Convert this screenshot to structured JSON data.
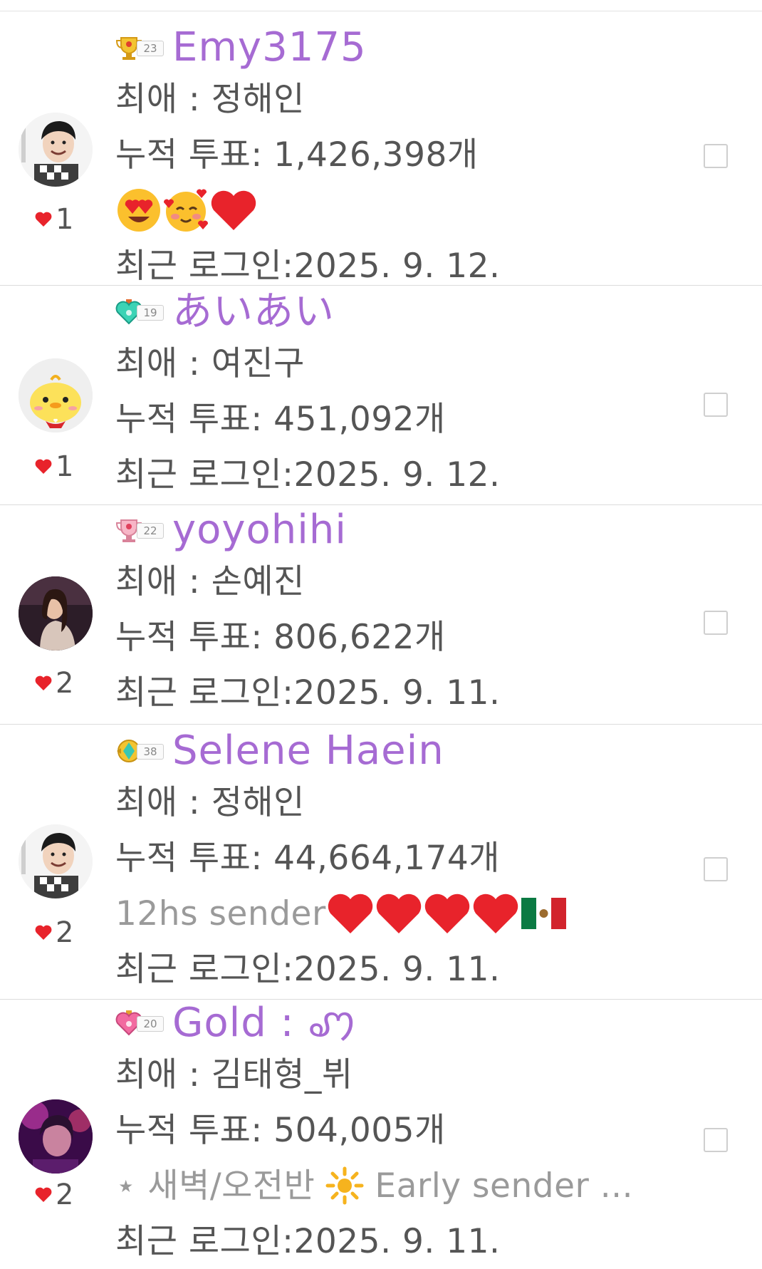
{
  "members": [
    {
      "level": "23",
      "nickname": "Emy3175",
      "favorite": "최애 : 정해인",
      "votes": "누적 투표: 1,426,398개",
      "message": "",
      "last_login": "최근 로그인:2025. 9. 12.",
      "likes": "1"
    },
    {
      "level": "19",
      "nickname": "あいあい",
      "favorite": "최애 : 여진구",
      "votes": "누적 투표: 451,092개",
      "message": "",
      "last_login": "최근 로그인:2025. 9. 12.",
      "likes": "1"
    },
    {
      "level": "22",
      "nickname": "yoyohihi",
      "favorite": "최애 : 손예진",
      "votes": "누적 투표: 806,622개",
      "message": "",
      "last_login": "최근 로그인:2025. 9. 11.",
      "likes": "2"
    },
    {
      "level": "38",
      "nickname": "Selene Haein",
      "favorite": "최애 : 정해인",
      "votes": "누적 투표: 44,664,174개",
      "message": "12hs sender",
      "last_login": "최근 로그인:2025. 9. 11.",
      "likes": "2"
    },
    {
      "level": "20",
      "nickname": "Gold : ꩇ",
      "favorite": "최애 : 김태형_뷔",
      "votes": "누적 투표: 504,005개",
      "message_prefix": "⋆ 새벽/오전반",
      "message": "Early sender ...",
      "last_login": "최근 로그인:2025. 9. 11.",
      "likes": "2"
    }
  ],
  "colors": {
    "nickname": "#a66bd3",
    "text": "#555555",
    "message": "#9a9a9a",
    "heart": "#e8232b",
    "divider": "#dcdcdc"
  }
}
